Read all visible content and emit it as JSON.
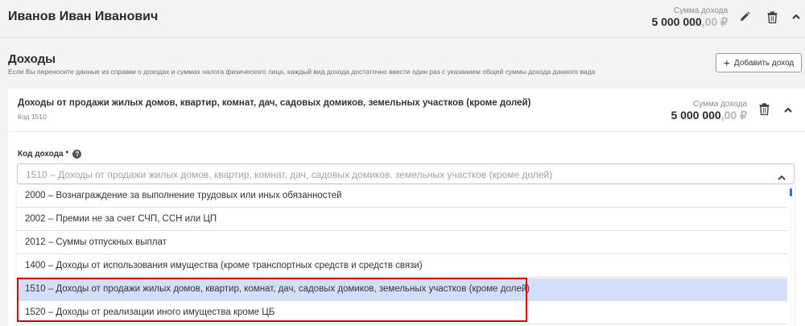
{
  "person": {
    "name": "Иванов Иван Иванович",
    "sum_caption": "Сумма дохода",
    "sum_main": "5 000 000",
    "sum_dec": ",00 ₽"
  },
  "section": {
    "title": "Доходы",
    "hint": "Если Вы переносите данные из справки о доходах и суммах налога физического лица, каждый вид дохода достаточно ввести один раз с указанием общей суммы дохода данного вида",
    "add_button": "Добавить доход"
  },
  "card": {
    "title": "Доходы от продажи жилых домов, квартир, комнат, дач, садовых домиков, земельных участков (кроме долей)",
    "code": "Код 1510",
    "sum_caption": "Сумма дохода",
    "sum_main": "5 000 000",
    "sum_dec": ",00 ₽"
  },
  "field": {
    "label": "Код дохода *",
    "help": "?",
    "value": "1510 – Доходы от продажи жилых домов, квартир, комнат, дач, садовых домиков, земельных участков (кроме долей)"
  },
  "options": [
    "2000 – Вознаграждение за выполнение трудовых или иных обязанностей",
    "2002 – Премии не за счет СЧП, ССН или ЦП",
    "2012 – Суммы отпускных выплат",
    "1400 – Доходы от использования имущества (кроме транспортных средств и средств связи)",
    "1510 – Доходы от продажи жилых домов, квартир, комнат, дач, садовых домиков, земельных участков (кроме долей)",
    "1520 – Доходы от реализации иного имущества кроме ЦБ"
  ],
  "selected_option_index": 4,
  "colors": {
    "selected_bg": "#d3dff8",
    "highlight_border": "#d60000",
    "scroll_thumb": "#2f6fd0"
  },
  "icons": [
    "edit-icon",
    "trash-icon",
    "chevron-up-icon",
    "plus-icon",
    "help-icon"
  ]
}
